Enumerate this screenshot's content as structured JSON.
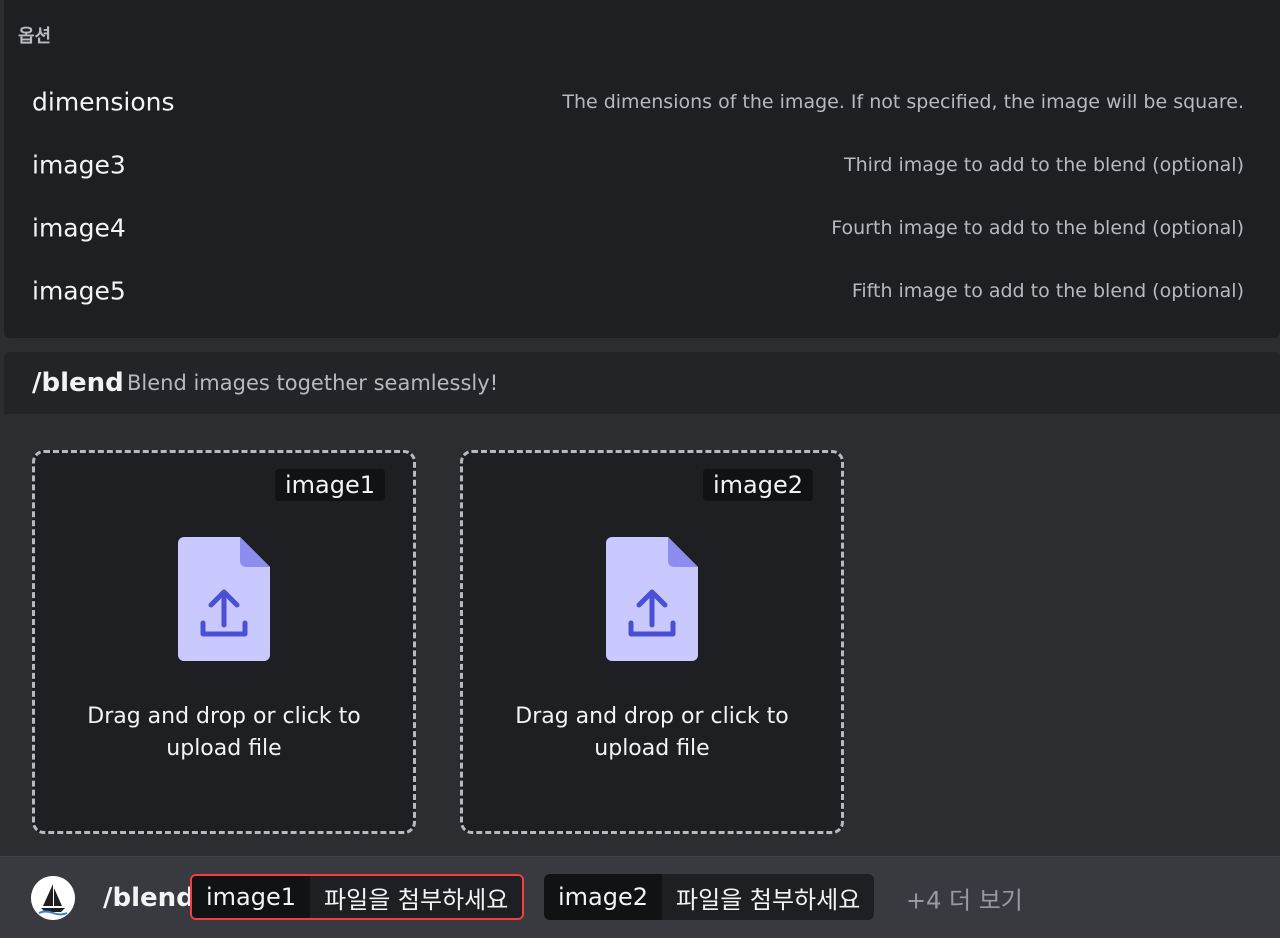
{
  "options": {
    "header": "옵션",
    "items": [
      {
        "name": "dimensions",
        "description": "The dimensions of the image. If not specified, the image will be square."
      },
      {
        "name": "image3",
        "description": "Third image to add to the blend (optional)"
      },
      {
        "name": "image4",
        "description": "Fourth image to add to the blend (optional)"
      },
      {
        "name": "image5",
        "description": "Fifth image to add to the blend (optional)"
      }
    ]
  },
  "command": {
    "name": "/blend",
    "description": "Blend images together seamlessly!"
  },
  "upload": {
    "zones": [
      {
        "label": "image1",
        "text": "Drag and drop or click to upload file",
        "icon": "file-upload-icon"
      },
      {
        "label": "image2",
        "text": "Drag and drop or click to upload file",
        "icon": "file-upload-icon"
      }
    ]
  },
  "input_bar": {
    "command": "/blend",
    "avatar_icon": "sailboat-avatar-icon",
    "params": [
      {
        "name": "image1",
        "value": "파일을 첨부하세요",
        "active": true
      },
      {
        "name": "image2",
        "value": "파일을 첨부하세요",
        "active": false
      }
    ],
    "more_label": "+4 더 보기"
  },
  "colors": {
    "background": "#2b2d31",
    "panel": "#1e1f22",
    "accent_error": "#f23f42",
    "file_icon": "#c9c8ff",
    "file_icon_arrow": "#4b4fd6"
  }
}
